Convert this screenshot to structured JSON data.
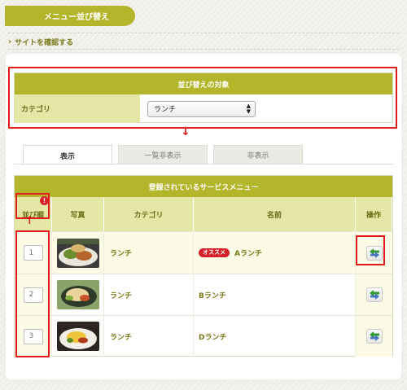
{
  "header": {
    "title": "メニュー並び替え"
  },
  "site_link": {
    "label": "サイトを確認する"
  },
  "target": {
    "heading": "並び替えの対象",
    "category_label": "カテゴリ",
    "category_value": "ランチ"
  },
  "tabs": [
    {
      "label": "表示",
      "active": true
    },
    {
      "label": "一覧非表示",
      "active": false
    },
    {
      "label": "非表示",
      "active": false
    }
  ],
  "menu_table": {
    "heading": "登録されているサービスメニュー",
    "columns": {
      "order": "並び順",
      "photo": "写真",
      "category": "カテゴリ",
      "name": "名前",
      "action": "操作"
    },
    "help_mark": "!",
    "rows": [
      {
        "order": "1",
        "category": "ランチ",
        "badge": "オススメ",
        "name": "Aランチ",
        "photo_icon": "lunch-plate-photo"
      },
      {
        "order": "2",
        "category": "ランチ",
        "badge": "",
        "name": "Bランチ",
        "photo_icon": "lunch-plate-photo"
      },
      {
        "order": "3",
        "category": "ランチ",
        "badge": "",
        "name": "Dランチ",
        "photo_icon": "lunch-plate-photo"
      }
    ]
  },
  "colors": {
    "accent": "#b3b52b",
    "header_light": "#e4e7a6",
    "highlight": "#e01b1b",
    "badge": "#d61f26"
  }
}
